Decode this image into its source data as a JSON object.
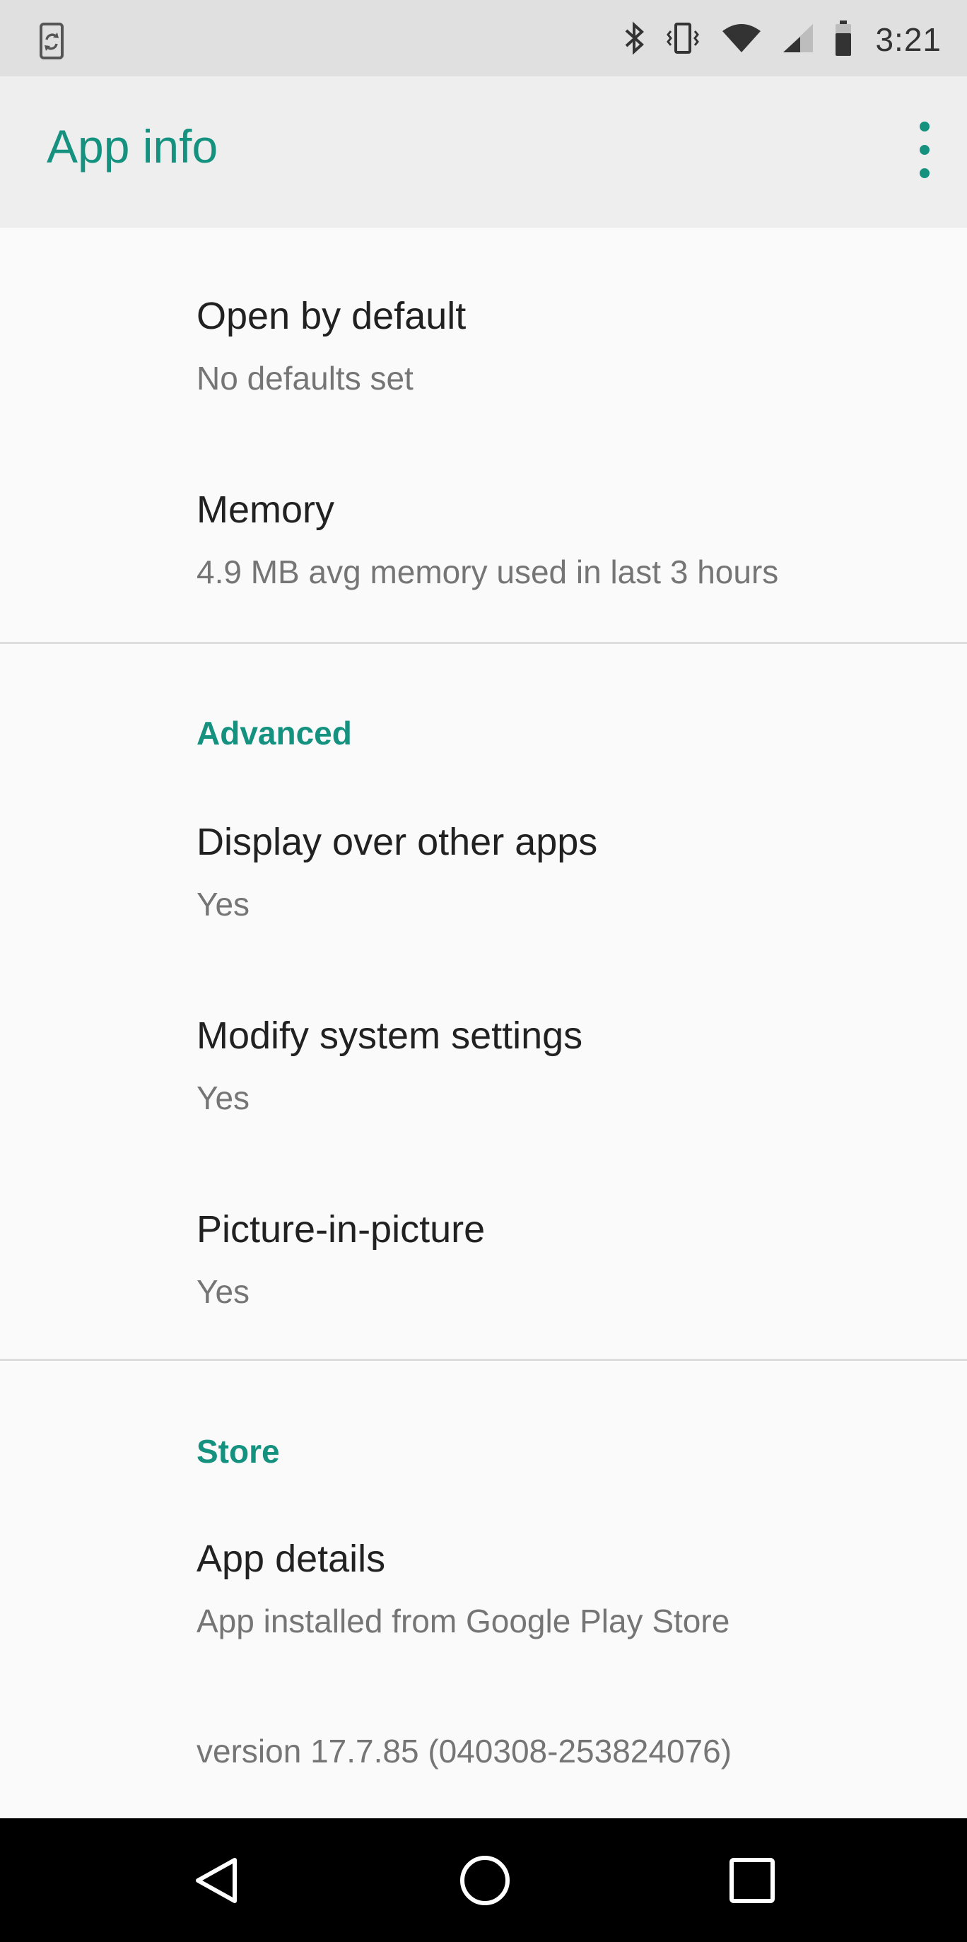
{
  "status_bar": {
    "left_icon": "phone-sync-icon",
    "icons": [
      "bluetooth-icon",
      "vibrate-icon",
      "wifi-icon",
      "cell-signal-icon",
      "battery-icon"
    ],
    "time": "3:21"
  },
  "app_bar": {
    "title": "App info",
    "menu_icon": "more-vert-icon"
  },
  "preferences": {
    "open_by_default": {
      "title": "Open by default",
      "summary": "No defaults set"
    },
    "memory": {
      "title": "Memory",
      "summary": "4.9 MB avg memory used in last 3 hours"
    }
  },
  "advanced": {
    "header": "Advanced",
    "items": [
      {
        "title": "Display over other apps",
        "summary": "Yes"
      },
      {
        "title": "Modify system settings",
        "summary": "Yes"
      },
      {
        "title": "Picture-in-picture",
        "summary": "Yes"
      }
    ]
  },
  "store": {
    "header": "Store",
    "app_details": {
      "title": "App details",
      "summary": "App installed from Google Play Store"
    },
    "version": "version 17.7.85 (040308-253824076)"
  },
  "nav_bar": {
    "buttons": [
      "back-icon",
      "home-icon",
      "recents-icon"
    ]
  },
  "colors": {
    "accent": "#14927f",
    "status_bar_bg": "#e0e0e0",
    "app_bar_bg": "#eeeeee",
    "background": "#fafafa",
    "nav_bar_bg": "#000000"
  }
}
